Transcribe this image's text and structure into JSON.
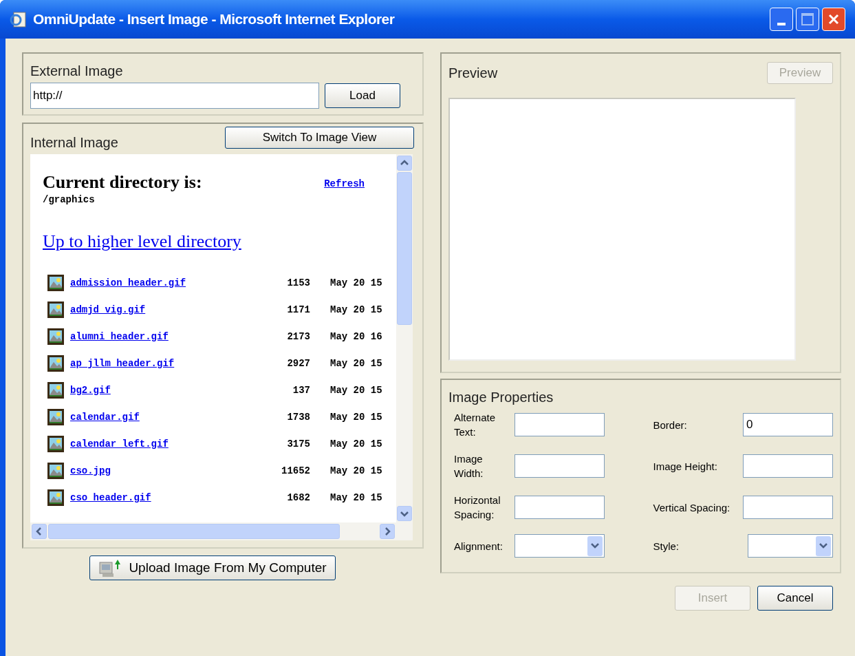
{
  "window": {
    "title": "OmniUpdate - Insert Image - Microsoft Internet Explorer"
  },
  "external_image": {
    "title": "External Image",
    "url": "http://",
    "load_button": "Load"
  },
  "internal_image": {
    "title": "Internal Image",
    "switch_button": "Switch To Image View",
    "heading": "Current directory is:",
    "directory": "/graphics",
    "refresh_link": "Refresh",
    "up_link": "Up to higher level directory",
    "files": [
      {
        "name": "admission_header.gif",
        "size": "1153",
        "date": "May 20 15"
      },
      {
        "name": "admjd_vig.gif",
        "size": "1171",
        "date": "May 20 15"
      },
      {
        "name": "alumni_header.gif",
        "size": "2173",
        "date": "May 20 16"
      },
      {
        "name": "ap_jllm_header.gif",
        "size": "2927",
        "date": "May 20 15"
      },
      {
        "name": "bg2.gif",
        "size": "137",
        "date": "May 20 15"
      },
      {
        "name": "calendar.gif",
        "size": "1738",
        "date": "May 20 15"
      },
      {
        "name": "calendar_left.gif",
        "size": "3175",
        "date": "May 20 15"
      },
      {
        "name": "cso.jpg",
        "size": "11652",
        "date": "May 20 15"
      },
      {
        "name": "cso_header.gif",
        "size": "1682",
        "date": "May 20 15"
      }
    ]
  },
  "upload_button": "Upload Image From My Computer",
  "preview": {
    "title": "Preview",
    "button": {
      "label": "Preview",
      "disabled": true
    }
  },
  "image_properties": {
    "title": "Image Properties",
    "fields": [
      {
        "label": "Alternate Text:",
        "kind": "text"
      },
      {
        "label": "Border:",
        "kind": "text",
        "value": "0"
      },
      {
        "label": "Image Width:",
        "kind": "text"
      },
      {
        "label": "Image Height:",
        "kind": "text"
      },
      {
        "label": "Horizontal Spacing:",
        "kind": "text"
      },
      {
        "label": "Vertical Spacing:",
        "kind": "text"
      },
      {
        "label": "Alignment:",
        "kind": "select"
      },
      {
        "label": "Style:",
        "kind": "select"
      }
    ]
  },
  "buttons": [
    {
      "label": "Insert",
      "disabled": true
    },
    {
      "label": "Cancel",
      "disabled": false
    }
  ]
}
